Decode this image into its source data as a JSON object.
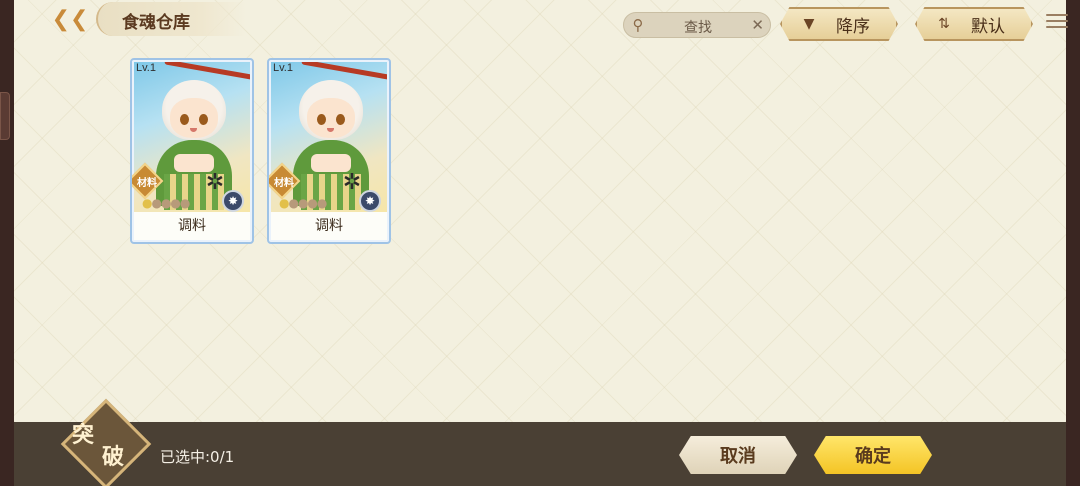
{
  "header": {
    "title": "食魂仓库",
    "back_icon": "back-arrow-icon",
    "search": {
      "placeholder": "查找",
      "icon": "search-icon",
      "clear_icon": "close-icon"
    },
    "sort_button": {
      "label": "降序",
      "icon": "triangle-down-icon"
    },
    "default_button": {
      "label": "默认",
      "icon": "sort-toggle-icon"
    }
  },
  "cards": [
    {
      "level": "Lv.1",
      "badge": "材料",
      "name": "调料",
      "stars_total": 5,
      "stars_filled": 1
    },
    {
      "level": "Lv.1",
      "badge": "材料",
      "name": "调料",
      "stars_total": 5,
      "stars_filled": 1
    }
  ],
  "footer": {
    "badge_line1": "突",
    "badge_line2": "破",
    "selected_label": "已选中:0/1",
    "cancel_label": "取消",
    "confirm_label": "确定"
  },
  "colors": {
    "panel_bg": "#f3f0df",
    "confirm_button": "#f4c425",
    "bottom_bar": "#4a4034"
  }
}
